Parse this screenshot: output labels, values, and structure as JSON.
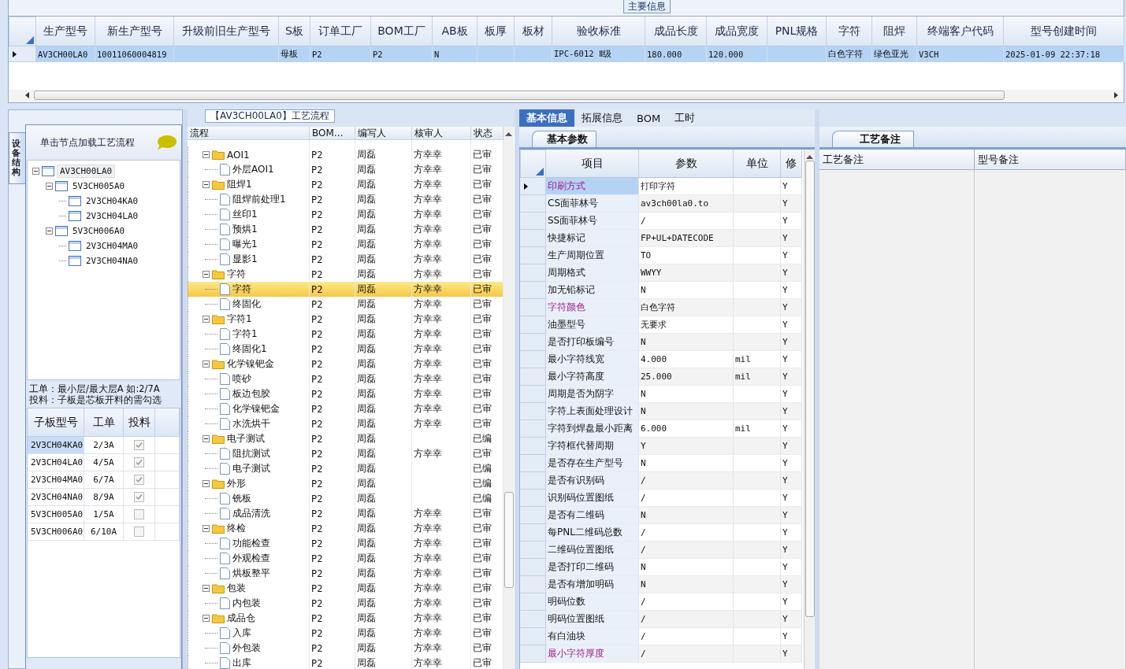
{
  "main_info": {
    "title": "主要信息",
    "columns": [
      "生产型号",
      "新生产型号",
      "升级前旧生产型号",
      "S板",
      "订单工厂",
      "BOM工厂",
      "AB板",
      "板厚",
      "板材",
      "验收标准",
      "成品长度",
      "成品宽度",
      "PNL规格",
      "字符",
      "阻焊",
      "终端客户代码",
      "型号创建时间"
    ],
    "rows": [
      {
        "selected": true,
        "cells": [
          "AV3CH00LA0",
          "10011060004819",
          "",
          "母板",
          "P2",
          "P2",
          "N",
          "",
          "",
          "IPC-6012 Ⅱ级",
          "180.000",
          "120.000",
          "",
          "白色字符",
          "绿色亚光",
          "V3CH",
          "2025-01-09 22:37:18"
        ]
      }
    ]
  },
  "side_tab": {
    "label": "设备结构"
  },
  "structure": {
    "hint": "单击节点加载工艺流程",
    "tree": [
      {
        "label": "AV3CH00LA0",
        "expanded": true,
        "selected": true,
        "children": [
          {
            "label": "5V3CH005A0",
            "expanded": true,
            "selected": false,
            "children": [
              {
                "label": "2V3CH04KA0",
                "selected": false
              },
              {
                "label": "2V3CH04LA0",
                "selected": false
              }
            ]
          },
          {
            "label": "5V3CH006A0",
            "expanded": true,
            "selected": false,
            "children": [
              {
                "label": "2V3CH04MA0",
                "selected": false
              },
              {
                "label": "2V3CH04NA0",
                "selected": false
              }
            ]
          }
        ]
      }
    ]
  },
  "note_lines": [
    "工单：最小层/最大层A 如:2/7A",
    "投料：子板是芯板开料的需勾选"
  ],
  "subboards": {
    "columns": [
      "子板型号",
      "工单",
      "投料"
    ],
    "rows": [
      {
        "model": "2V3CH04KA0",
        "order": "2/3A",
        "checked": true,
        "selected": true
      },
      {
        "model": "2V3CH04LA0",
        "order": "4/5A",
        "checked": true,
        "selected": false
      },
      {
        "model": "2V3CH04MA0",
        "order": "6/7A",
        "checked": true,
        "selected": false
      },
      {
        "model": "2V3CH04NA0",
        "order": "8/9A",
        "checked": true,
        "selected": false
      },
      {
        "model": "5V3CH005A0",
        "order": "1/5A",
        "checked": false,
        "selected": false
      },
      {
        "model": "5V3CH006A0",
        "order": "6/10A",
        "checked": false,
        "selected": false
      }
    ]
  },
  "flow": {
    "title": "【AV3CH00LA0】工艺流程",
    "columns": [
      "流程",
      "BOM…",
      "编写人",
      "核审人",
      "状态"
    ],
    "groups": [
      {
        "name": "AOI1",
        "bom": "P2",
        "writer": "周磊",
        "reviewer": "方幸幸",
        "status": "已审",
        "expanded": true,
        "selected": false,
        "children": [
          {
            "name": "外层AOI1",
            "bom": "P2",
            "writer": "周磊",
            "reviewer": "方幸幸",
            "status": "已审",
            "selected": false
          }
        ]
      },
      {
        "name": "阻焊1",
        "bom": "P2",
        "writer": "周磊",
        "reviewer": "方幸幸",
        "status": "已审",
        "expanded": true,
        "selected": false,
        "children": [
          {
            "name": "阻焊前处理1",
            "bom": "P2",
            "writer": "周磊",
            "reviewer": "方幸幸",
            "status": "已审",
            "selected": false
          },
          {
            "name": "丝印1",
            "bom": "P2",
            "writer": "周磊",
            "reviewer": "方幸幸",
            "status": "已审",
            "selected": false
          },
          {
            "name": "预烘1",
            "bom": "P2",
            "writer": "周磊",
            "reviewer": "方幸幸",
            "status": "已审",
            "selected": false
          },
          {
            "name": "曝光1",
            "bom": "P2",
            "writer": "周磊",
            "reviewer": "方幸幸",
            "status": "已审",
            "selected": false
          },
          {
            "name": "显影1",
            "bom": "P2",
            "writer": "周磊",
            "reviewer": "方幸幸",
            "status": "已审",
            "selected": false
          }
        ]
      },
      {
        "name": "字符",
        "bom": "P2",
        "writer": "周磊",
        "reviewer": "方幸幸",
        "status": "已审",
        "expanded": true,
        "selected": false,
        "children": [
          {
            "name": "字符",
            "bom": "P2",
            "writer": "周磊",
            "reviewer": "方幸幸",
            "status": "已审",
            "selected": true
          },
          {
            "name": "终固化",
            "bom": "P2",
            "writer": "周磊",
            "reviewer": "方幸幸",
            "status": "已审",
            "selected": false
          }
        ]
      },
      {
        "name": "字符1",
        "bom": "P2",
        "writer": "周磊",
        "reviewer": "方幸幸",
        "status": "已审",
        "expanded": true,
        "selected": false,
        "children": [
          {
            "name": "字符1",
            "bom": "P2",
            "writer": "周磊",
            "reviewer": "方幸幸",
            "status": "已审",
            "selected": false
          },
          {
            "name": "终固化1",
            "bom": "P2",
            "writer": "周磊",
            "reviewer": "方幸幸",
            "status": "已审",
            "selected": false
          }
        ]
      },
      {
        "name": "化学镍钯金",
        "bom": "P2",
        "writer": "周磊",
        "reviewer": "方幸幸",
        "status": "已审",
        "expanded": true,
        "selected": false,
        "children": [
          {
            "name": "喷砂",
            "bom": "P2",
            "writer": "周磊",
            "reviewer": "方幸幸",
            "status": "已审",
            "selected": false
          },
          {
            "name": "板边包胶",
            "bom": "P2",
            "writer": "周磊",
            "reviewer": "方幸幸",
            "status": "已审",
            "selected": false
          },
          {
            "name": "化学镍钯金",
            "bom": "P2",
            "writer": "周磊",
            "reviewer": "方幸幸",
            "status": "已审",
            "selected": false
          },
          {
            "name": "水洗烘干",
            "bom": "P2",
            "writer": "周磊",
            "reviewer": "方幸幸",
            "status": "已审",
            "selected": false
          }
        ]
      },
      {
        "name": "电子测试",
        "bom": "P2",
        "writer": "周磊",
        "status": "已编",
        "expanded": true,
        "selected": false,
        "children": [
          {
            "name": "阻抗测试",
            "bom": "P2",
            "writer": "周磊",
            "reviewer": "方幸幸",
            "status": "已审",
            "selected": false
          },
          {
            "name": "电子测试",
            "bom": "P2",
            "writer": "周磊",
            "status": "已编",
            "selected": false
          }
        ]
      },
      {
        "name": "外形",
        "bom": "P2",
        "writer": "周磊",
        "status": "已编",
        "expanded": true,
        "selected": false,
        "children": [
          {
            "name": "铣板",
            "bom": "P2",
            "writer": "周磊",
            "status": "已编",
            "selected": false
          },
          {
            "name": "成品清洗",
            "bom": "P2",
            "writer": "周磊",
            "reviewer": "方幸幸",
            "status": "已审",
            "selected": false
          }
        ]
      },
      {
        "name": "终检",
        "bom": "P2",
        "writer": "周磊",
        "reviewer": "方幸幸",
        "status": "已审",
        "expanded": true,
        "selected": false,
        "children": [
          {
            "name": "功能检查",
            "bom": "P2",
            "writer": "周磊",
            "reviewer": "方幸幸",
            "status": "已审",
            "selected": false
          },
          {
            "name": "外观检查",
            "bom": "P2",
            "writer": "周磊",
            "reviewer": "方幸幸",
            "status": "已审",
            "selected": false
          },
          {
            "name": "烘板整平",
            "bom": "P2",
            "writer": "周磊",
            "reviewer": "方幸幸",
            "status": "已审",
            "selected": false
          }
        ]
      },
      {
        "name": "包装",
        "bom": "P2",
        "writer": "周磊",
        "reviewer": "方幸幸",
        "status": "已审",
        "expanded": true,
        "selected": false,
        "children": [
          {
            "name": "内包装",
            "bom": "P2",
            "writer": "周磊",
            "reviewer": "方幸幸",
            "status": "已审",
            "selected": false
          }
        ]
      },
      {
        "name": "成品仓",
        "bom": "P2",
        "writer": "周磊",
        "reviewer": "方幸幸",
        "status": "已审",
        "expanded": true,
        "selected": false,
        "children": [
          {
            "name": "入库",
            "bom": "P2",
            "writer": "周磊",
            "reviewer": "方幸幸",
            "status": "已审",
            "selected": false
          },
          {
            "name": "外包装",
            "bom": "P2",
            "writer": "周磊",
            "reviewer": "方幸幸",
            "status": "已审",
            "selected": false
          },
          {
            "name": "出库",
            "bom": "P2",
            "writer": "周磊",
            "reviewer": "方幸幸",
            "status": "已审",
            "selected": false
          }
        ]
      }
    ]
  },
  "detail": {
    "tabs": [
      {
        "label": "基本信息",
        "selected": true
      },
      {
        "label": "拓展信息",
        "selected": false
      },
      {
        "label": "BOM",
        "selected": false
      },
      {
        "label": "工时",
        "selected": false
      }
    ],
    "subtab": "基本参数",
    "columns": [
      "项目",
      "参数",
      "单位",
      "修"
    ],
    "rows": [
      {
        "item": "印刷方式",
        "value": "打印字符",
        "flag": "Y",
        "flagged": true,
        "selected": true
      },
      {
        "item": "CS面菲林号",
        "value": "av3ch00la0.to",
        "flag": "Y",
        "flagged": false,
        "selected": false
      },
      {
        "item": "SS面菲林号",
        "value": "/",
        "flag": "Y",
        "flagged": false,
        "selected": false
      },
      {
        "item": "快捷标记",
        "value": "FP+UL+DATECODE",
        "flag": "Y",
        "flagged": false,
        "selected": false
      },
      {
        "item": "生产周期位置",
        "value": "TO",
        "flag": "Y",
        "flagged": false,
        "selected": false
      },
      {
        "item": "周期格式",
        "value": "WWYY",
        "flag": "Y",
        "flagged": false,
        "selected": false
      },
      {
        "item": "加无铅标记",
        "value": "N",
        "flag": "Y",
        "flagged": false,
        "selected": false
      },
      {
        "item": "字符颜色",
        "value": "白色字符",
        "flag": "Y",
        "flagged": true,
        "selected": false
      },
      {
        "item": "油墨型号",
        "value": "无要求",
        "flag": "Y",
        "flagged": false,
        "selected": false
      },
      {
        "item": "是否打印板编号",
        "value": "N",
        "flag": "Y",
        "flagged": false,
        "selected": false
      },
      {
        "item": "最小字符线宽",
        "value": "4.000",
        "unit": "mil",
        "flag": "Y",
        "flagged": false,
        "selected": false
      },
      {
        "item": "最小字符高度",
        "value": "25.000",
        "unit": "mil",
        "flag": "Y",
        "flagged": false,
        "selected": false
      },
      {
        "item": "周期是否为阴字",
        "value": "N",
        "flag": "Y",
        "flagged": false,
        "selected": false
      },
      {
        "item": "字符上表面处理设计",
        "value": "N",
        "flag": "Y",
        "flagged": false,
        "selected": false
      },
      {
        "item": "字符到焊盘最小距离",
        "value": "6.000",
        "unit": "mil",
        "flag": "Y",
        "flagged": false,
        "selected": false
      },
      {
        "item": "字符框代替周期",
        "value": "Y",
        "flag": "Y",
        "flagged": false,
        "selected": false
      },
      {
        "item": "是否存在生产型号",
        "value": "N",
        "flag": "Y",
        "flagged": false,
        "selected": false
      },
      {
        "item": "是否有识别码",
        "value": "/",
        "flag": "Y",
        "flagged": false,
        "selected": false
      },
      {
        "item": "识别码位置图纸",
        "value": "/",
        "flag": "Y",
        "flagged": false,
        "selected": false
      },
      {
        "item": "是否有二维码",
        "value": "N",
        "flag": "Y",
        "flagged": false,
        "selected": false
      },
      {
        "item": "每PNL二维码总数",
        "value": "/",
        "flag": "Y",
        "flagged": false,
        "selected": false
      },
      {
        "item": "二维码位置图纸",
        "value": "/",
        "flag": "Y",
        "flagged": false,
        "selected": false
      },
      {
        "item": "是否打印二维码",
        "value": "N",
        "flag": "Y",
        "flagged": false,
        "selected": false
      },
      {
        "item": "是否有增加明码",
        "value": "N",
        "flag": "Y",
        "flagged": false,
        "selected": false
      },
      {
        "item": "明码位数",
        "value": "/",
        "flag": "Y",
        "flagged": false,
        "selected": false
      },
      {
        "item": "明码位置图纸",
        "value": "/",
        "flag": "Y",
        "flagged": false,
        "selected": false
      },
      {
        "item": "有白油块",
        "value": "/",
        "flag": "Y",
        "flagged": false,
        "selected": false
      },
      {
        "item": "最小字符厚度",
        "value": "/",
        "flag": "Y",
        "flagged": true,
        "selected": false
      }
    ]
  },
  "remarks": {
    "tab": "工艺备注",
    "columns": [
      "工艺备注",
      "型号备注"
    ]
  }
}
